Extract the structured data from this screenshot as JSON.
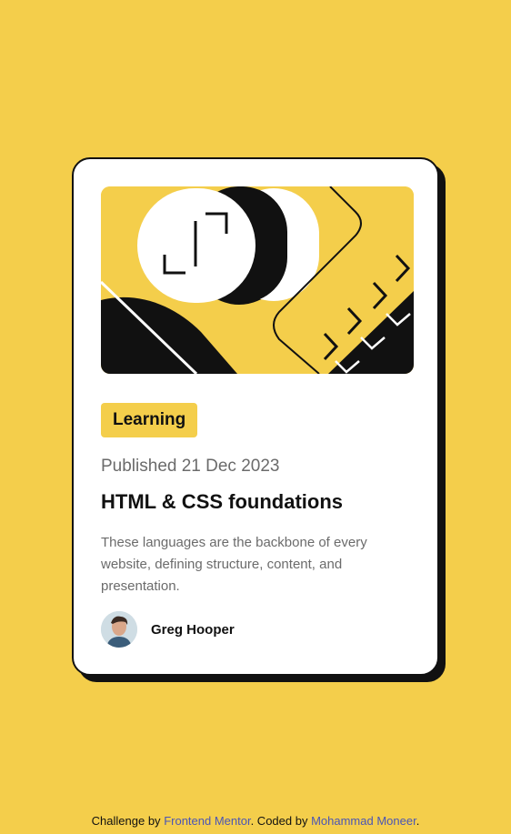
{
  "card": {
    "image_alt": "illustration-article",
    "category": "Learning",
    "published": "Published 21 Dec 2023",
    "title": "HTML & CSS foundations",
    "description": "These languages are the backbone of every website, defining structure, content, and presentation.",
    "author": {
      "name": "Greg Hooper"
    }
  },
  "attribution": {
    "prefix": "Challenge by",
    "challenge_link": "Frontend Mentor",
    "middle": ". Coded by",
    "coder_link": "Mohammad Moneer",
    "suffix": "."
  },
  "colors": {
    "background": "#F4CE4B",
    "card": "#FFFFFF",
    "text_dark": "#111111",
    "text_muted": "#6B6B6B",
    "link": "#4A55B5"
  }
}
